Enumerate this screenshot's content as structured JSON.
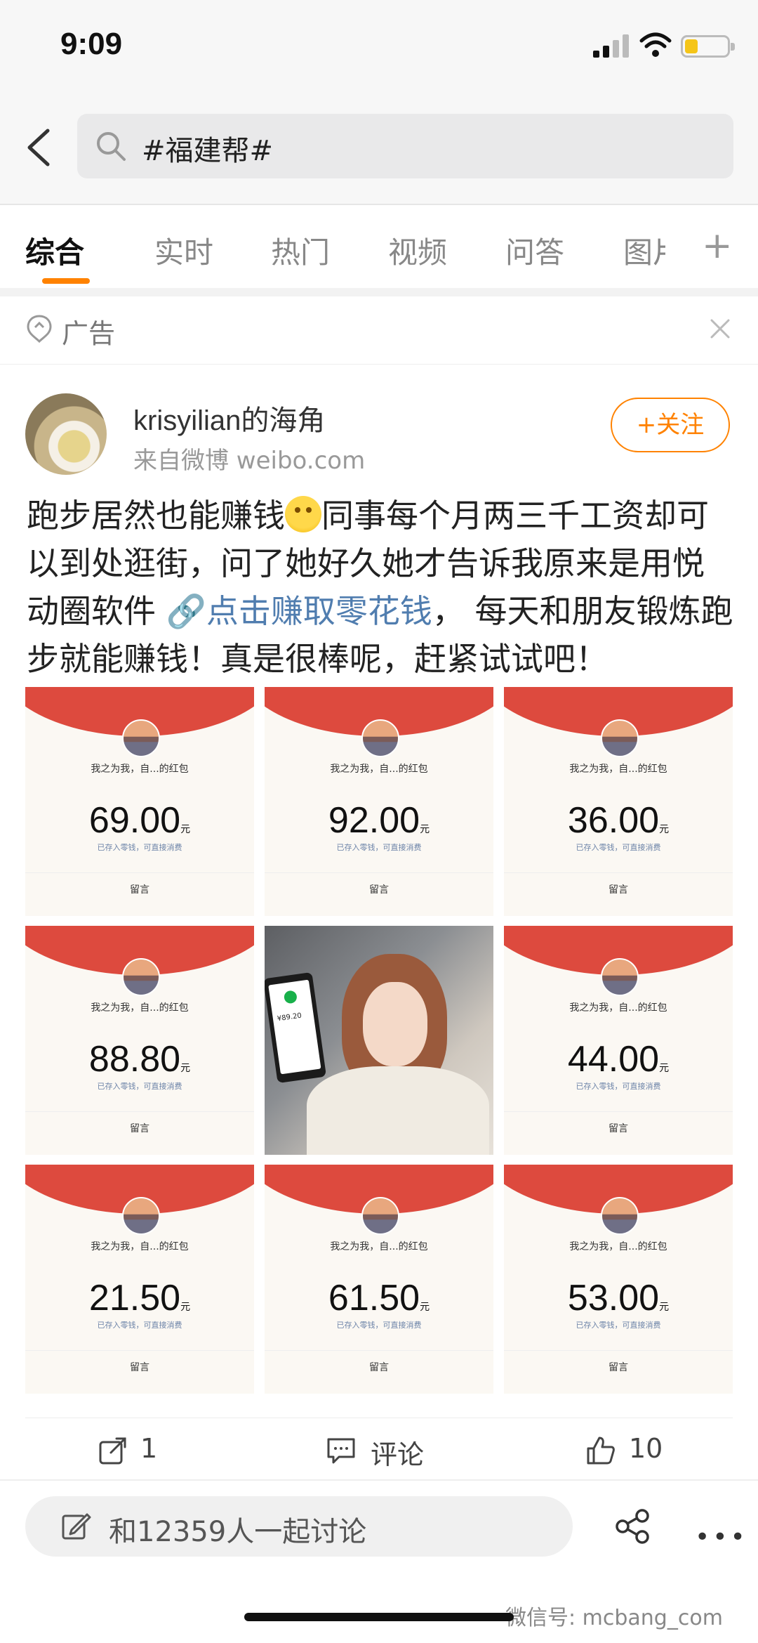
{
  "status": {
    "time": "9:09"
  },
  "search": {
    "query": "#福建帮#"
  },
  "tabs": [
    "综合",
    "实时",
    "热门",
    "视频",
    "问答",
    "图片"
  ],
  "ad": {
    "label": "广告"
  },
  "post": {
    "username": "krisyilian的海角",
    "source": "来自微博 weibo.com",
    "follow": "+关注",
    "text_before": "跑步居然也能赚钱",
    "text_mid": "同事每个月两三千工资却可以到处逛街，问了她好久她才告诉我原来是用悦动圈软件 ",
    "link": "点击赚取零花钱",
    "text_after": "， 每天和朋友锻炼跑步就能赚钱！真是很棒呢，赶紧试试吧！"
  },
  "grid": [
    {
      "type": "redpacket",
      "from": "我之为我，自...的红包",
      "amount": "69.00",
      "unit": "元",
      "hint": "已存入零钱，可直接消费",
      "msg": "留言"
    },
    {
      "type": "redpacket",
      "from": "我之为我，自...的红包",
      "amount": "92.00",
      "unit": "元",
      "hint": "已存入零钱，可直接消费",
      "msg": "留言"
    },
    {
      "type": "redpacket",
      "from": "我之为我，自...的红包",
      "amount": "36.00",
      "unit": "元",
      "hint": "已存入零钱，可直接消费",
      "msg": "留言"
    },
    {
      "type": "redpacket",
      "from": "我之为我，自...的红包",
      "amount": "88.80",
      "unit": "元",
      "hint": "已存入零钱，可直接消费",
      "msg": "留言"
    },
    {
      "type": "photo",
      "phone_text": "¥89.20"
    },
    {
      "type": "redpacket",
      "from": "我之为我，自...的红包",
      "amount": "44.00",
      "unit": "元",
      "hint": "已存入零钱，可直接消费",
      "msg": "留言"
    },
    {
      "type": "redpacket",
      "from": "我之为我，自...的红包",
      "amount": "21.50",
      "unit": "元",
      "hint": "已存入零钱，可直接消费",
      "msg": "留言"
    },
    {
      "type": "redpacket",
      "from": "我之为我，自...的红包",
      "amount": "61.50",
      "unit": "元",
      "hint": "已存入零钱，可直接消费",
      "msg": "留言"
    },
    {
      "type": "redpacket",
      "from": "我之为我，自...的红包",
      "amount": "53.00",
      "unit": "元",
      "hint": "已存入零钱，可直接消费",
      "msg": "留言"
    }
  ],
  "actions": {
    "repost_count": "1",
    "comment_label": "评论",
    "like_count": "10"
  },
  "comment_bar": {
    "placeholder": "和12359人一起讨论"
  },
  "watermark": "微信号: mcbang_com",
  "colors": {
    "accent": "#ff8200",
    "link": "#507daf",
    "redpacket": "#dd4a3e"
  }
}
